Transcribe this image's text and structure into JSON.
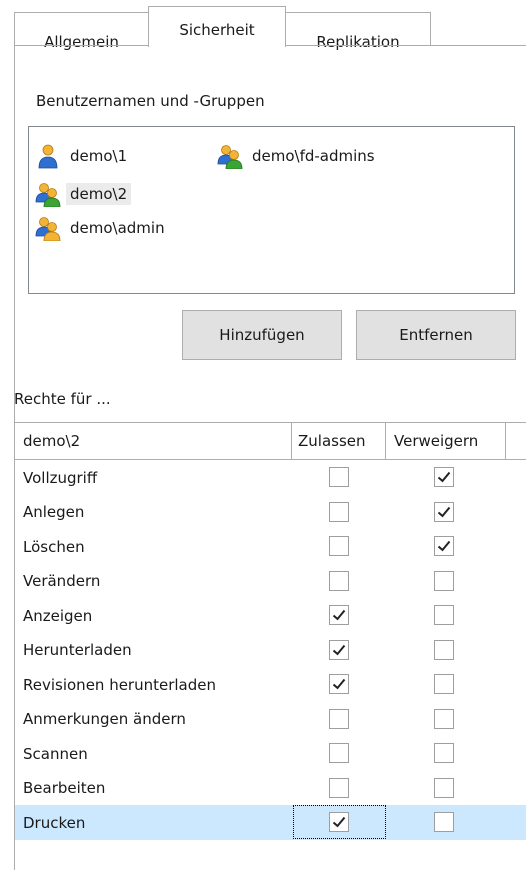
{
  "tabs": [
    {
      "label": "Allgemein"
    },
    {
      "label": "Sicherheit"
    },
    {
      "label": "Replikation"
    }
  ],
  "users_label": "Benutzernamen und -Gruppen",
  "users": [
    {
      "name": "demo\\1",
      "kind": "user-icon"
    },
    {
      "name": "demo\\fd-admins",
      "kind": "group-icon"
    },
    {
      "name": "demo\\2",
      "kind": "group-icon"
    },
    {
      "name": "demo\\admin",
      "kind": "group-icon"
    }
  ],
  "buttons": {
    "add": "Hinzufügen",
    "remove": "Entfernen"
  },
  "rights_label": "Rechte für ...",
  "table": {
    "principal": "demo\\2",
    "allow_header": "Zulassen",
    "deny_header": "Verweigern",
    "rows": [
      {
        "name": "Vollzugriff",
        "allow": false,
        "deny": true
      },
      {
        "name": "Anlegen",
        "allow": false,
        "deny": true
      },
      {
        "name": "Löschen",
        "allow": false,
        "deny": true
      },
      {
        "name": "Verändern",
        "allow": false,
        "deny": false
      },
      {
        "name": "Anzeigen",
        "allow": true,
        "deny": false
      },
      {
        "name": "Herunterladen",
        "allow": true,
        "deny": false
      },
      {
        "name": "Revisionen herunterladen",
        "allow": true,
        "deny": false
      },
      {
        "name": "Anmerkungen ändern",
        "allow": false,
        "deny": false
      },
      {
        "name": "Scannen",
        "allow": false,
        "deny": false
      },
      {
        "name": "Bearbeiten",
        "allow": false,
        "deny": false
      },
      {
        "name": "Drucken",
        "allow": true,
        "deny": false
      }
    ]
  },
  "colors": {
    "selection": "#cce8ff",
    "border": "#adadad",
    "button_face": "#e1e1e1"
  }
}
